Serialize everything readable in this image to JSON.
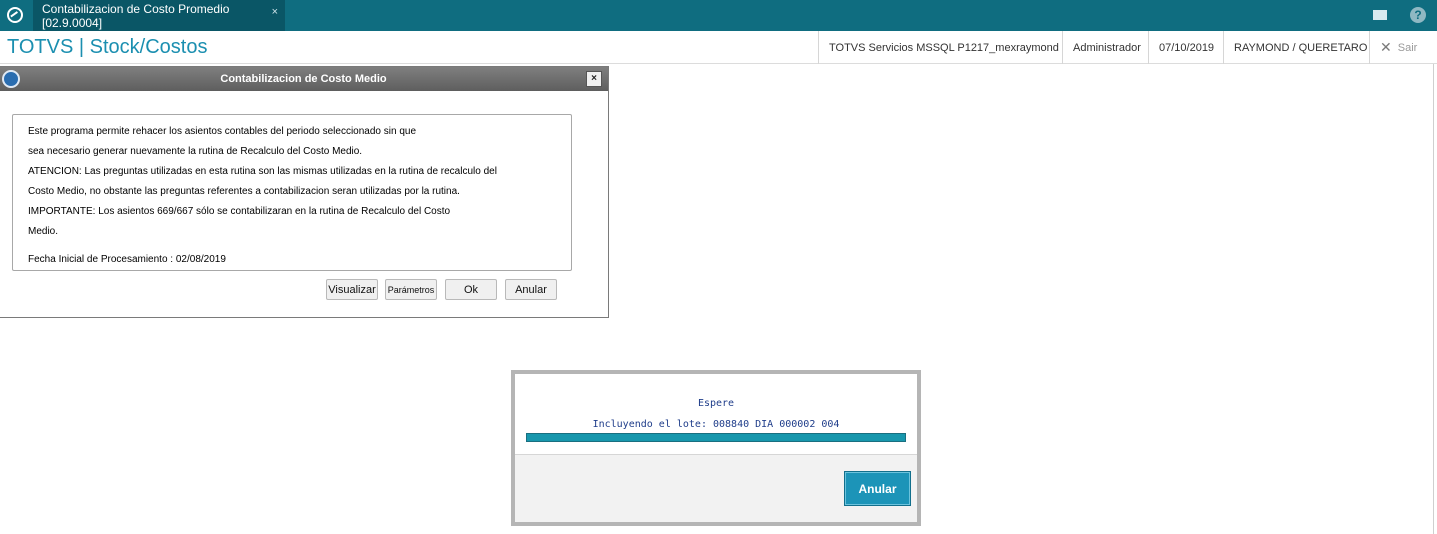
{
  "topbar": {
    "tab_title": "Contabilizacion de Costo Promedio [02.9.0004]",
    "tab_close": "×",
    "mail_icon": "mail-icon",
    "help_icon": "help-icon",
    "help_glyph": "?"
  },
  "header": {
    "brand": "TOTVS | Stock/Costos",
    "server": "TOTVS Servicios MSSQL P1217_mexraymond",
    "user": "Administrador",
    "date": "07/10/2019",
    "branch": "RAYMOND / QUERETARO",
    "exit_glyph": "✕",
    "exit_label": "Sair"
  },
  "dialog": {
    "title": "Contabilizacion de Costo Medio",
    "close_glyph": "×",
    "lines": [
      "Este programa permite rehacer los asientos contables del periodo seleccionado sin que",
      "sea necesario generar nuevamente la rutina de Recalculo del Costo Medio.",
      "ATENCION: Las preguntas utilizadas en esta rutina son las mismas utilizadas en la rutina de recalculo del",
      "Costo Medio, no obstante las preguntas referentes a contabilizacion seran utilizadas por la rutina.",
      "IMPORTANTE: Los asientos 669/667 sólo se contabilizaran en la rutina de Recalculo del Costo",
      "Medio.",
      "Fecha Inicial de Procesamiento : 02/08/2019"
    ],
    "buttons": {
      "visualizar": "Visualizar",
      "parametros": "Parámetros",
      "ok": "Ok",
      "anular": "Anular"
    }
  },
  "wait": {
    "title": "Espere",
    "message": "Incluyendo el lote: 008840 DIA 000002 004",
    "progress": 1.0,
    "cancel_label": "Anular"
  },
  "colors": {
    "topbar": "#0f6d80",
    "brand": "#1b8fb0",
    "progress": "#1897ad",
    "primary_button": "#1c94b8"
  }
}
